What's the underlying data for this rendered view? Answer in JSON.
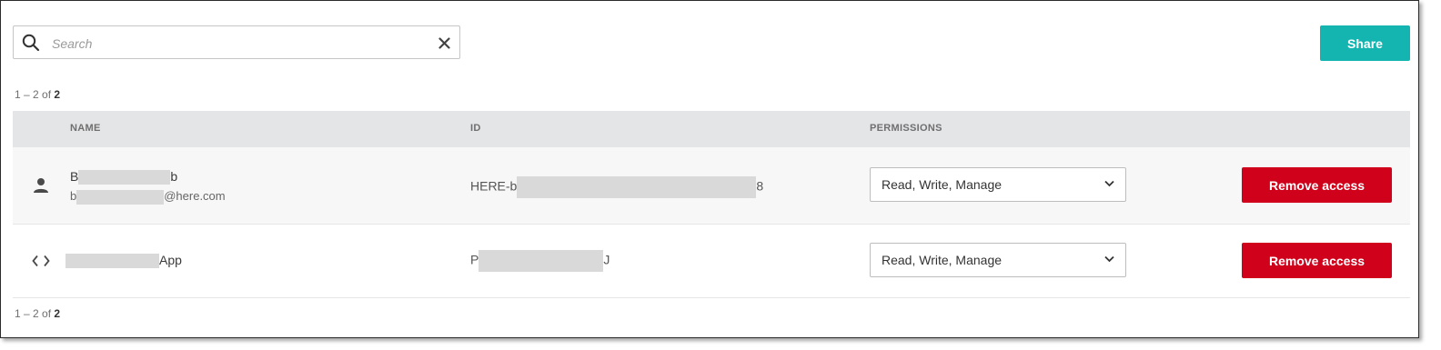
{
  "search": {
    "placeholder": "Search",
    "value": ""
  },
  "share_label": "Share",
  "pagination": {
    "prefix": "1 – 2 of ",
    "total": "2"
  },
  "columns": {
    "name": "NAME",
    "id": "ID",
    "permissions": "PERMISSIONS"
  },
  "rows": [
    {
      "type_icon": "person-icon",
      "name_start": "B",
      "name_end": "b",
      "email_start": "b",
      "email_end": "@here.com",
      "id_start": "HERE-b",
      "id_end": "8",
      "permission": "Read, Write, Manage",
      "action_label": "Remove access"
    },
    {
      "type_icon": "code-icon",
      "name_end": "App",
      "id_start": "P",
      "id_end": "J",
      "permission": "Read, Write, Manage",
      "action_label": "Remove access"
    }
  ],
  "colors": {
    "share": "#14b5b0",
    "remove": "#d0021b",
    "header_bg": "#e4e5e7"
  }
}
